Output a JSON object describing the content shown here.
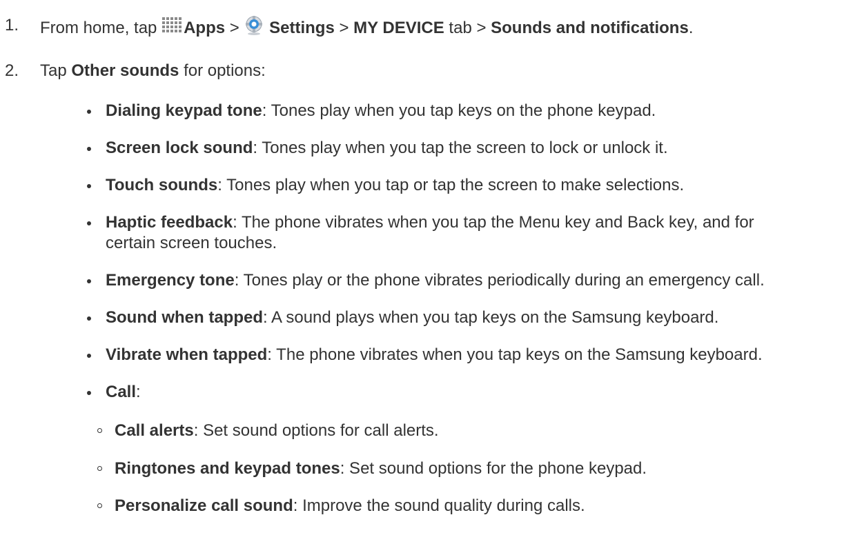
{
  "step1": {
    "number": "1.",
    "prefix": "From home, tap",
    "apps": "Apps",
    "sep1": ">",
    "settings": "Settings",
    "sep2": ">",
    "my_device": "MY DEVICE",
    "tab": "tab >",
    "sounds": "Sounds and notifications",
    "period": ".",
    "apps_icon": "apps-grid-icon",
    "settings_icon": "settings-gear-icon"
  },
  "step2": {
    "number": "2.",
    "prefix": "Tap",
    "other": "Other sounds",
    "suffix": "for options:"
  },
  "options": [
    {
      "term": "Dialing keypad tone",
      "desc": ": Tones play when you tap keys on the phone keypad."
    },
    {
      "term": "Screen lock sound",
      "desc": ": Tones play when you tap the screen to lock or unlock it."
    },
    {
      "term": "Touch sounds",
      "desc": ": Tones play when you tap or tap the screen to make selections."
    },
    {
      "term": "Haptic feedback",
      "desc": ": The phone vibrates when you tap the Menu key and Back key, and for",
      "desc2": "certain screen touches."
    },
    {
      "term": "Emergency tone",
      "desc": ": Tones play or the phone vibrates periodically during an emergency call."
    },
    {
      "term": "Sound when tapped",
      "desc": ": A sound plays when you tap keys on the Samsung keyboard."
    },
    {
      "term": "Vibrate when tapped",
      "desc": ": The phone vibrates when you tap keys on the Samsung keyboard."
    },
    {
      "term": "Call",
      "desc": ":"
    }
  ],
  "call_options": [
    {
      "term": "Call alerts",
      "desc": ": Set sound options for call alerts."
    },
    {
      "term": "Ringtones and keypad tones",
      "desc": ": Set sound options for the phone keypad."
    },
    {
      "term": "Personalize call sound",
      "desc": ": Improve the sound quality during calls."
    }
  ]
}
